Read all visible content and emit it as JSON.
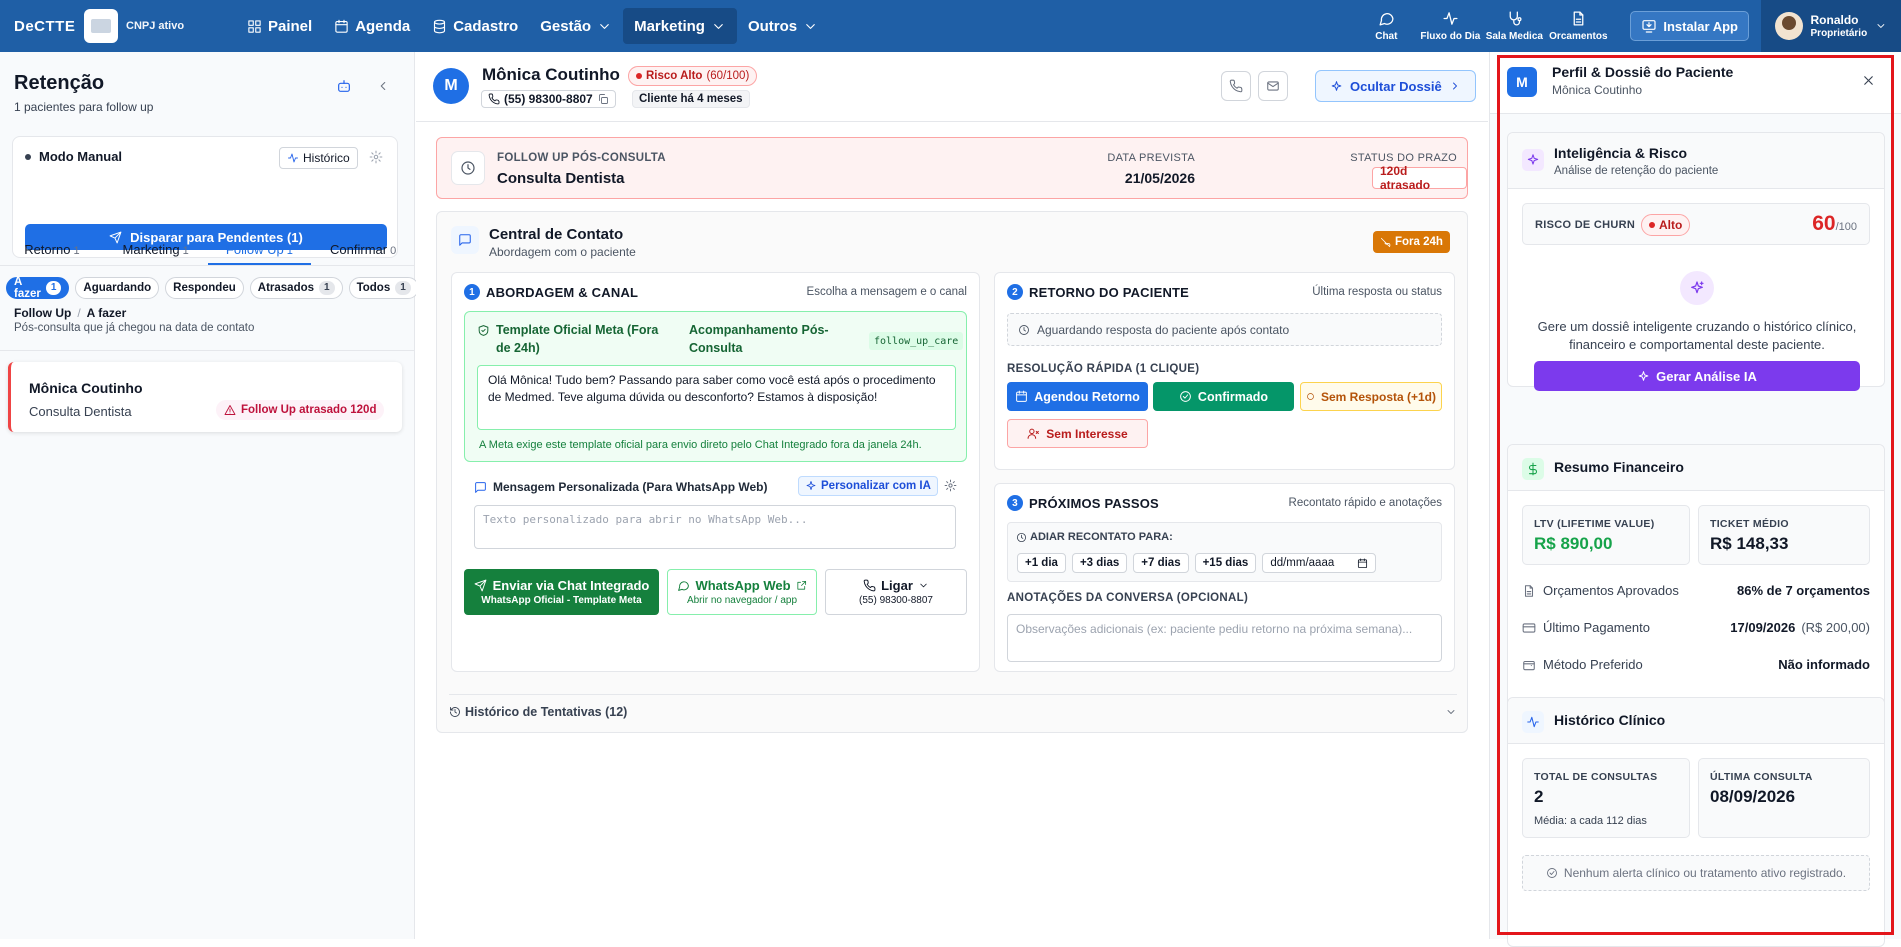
{
  "topbar": {
    "logo": "DeCTTE",
    "cnpj": "CNPJ ativo",
    "nav": [
      {
        "label": "Painel",
        "icon": "grid-icon"
      },
      {
        "label": "Agenda",
        "icon": "calendar-icon"
      },
      {
        "label": "Cadastro",
        "icon": "database-icon"
      },
      {
        "label": "Gestão",
        "icon": "chevron-down-icon"
      },
      {
        "label": "Marketing",
        "icon": "chevron-down-icon"
      },
      {
        "label": "Outros",
        "icon": "chevron-down-icon"
      }
    ],
    "tools": [
      "Chat",
      "Fluxo do Dia",
      "Sala Medica",
      "Orcamentos"
    ],
    "install": "Instalar App",
    "user_name": "Ronaldo",
    "user_role": "Proprietário"
  },
  "left": {
    "title": "Retenção",
    "subtitle": "1 pacientes para follow up",
    "mode": "Modo Manual",
    "history_btn": "Histórico",
    "fire_btn": "Disparar para Pendentes (1)",
    "tabs": [
      {
        "label": "Retorno",
        "count": "1"
      },
      {
        "label": "Marketing",
        "count": "1"
      },
      {
        "label": "Follow Up",
        "count": "1"
      },
      {
        "label": "Confirmar",
        "count": "0"
      }
    ],
    "pills": [
      {
        "label": "A fazer",
        "count": "1"
      },
      {
        "label": "Aguardando",
        "count": ""
      },
      {
        "label": "Respondeu",
        "count": ""
      },
      {
        "label": "Atrasados",
        "count": "1"
      },
      {
        "label": "Todos",
        "count": "1"
      }
    ],
    "crumb1": "Follow Up",
    "crumb_sep": "/",
    "crumb2": "A fazer",
    "crumb_sub": "Pós-consulta que já chegou na data de contato",
    "card_name": "Mônica Coutinho",
    "card_desc": "Consulta Dentista",
    "card_badge": "Follow Up atrasado 120d"
  },
  "mid": {
    "initial": "M",
    "name": "Mônica Coutinho",
    "risk_label": "Risco Alto",
    "risk_score": "(60/100)",
    "phone": "(55) 98300-8807",
    "since": "Cliente há 4 meses",
    "hide_btn": "Ocultar Dossiê",
    "fup_label": "FOLLOW UP PÓS-CONSULTA",
    "fup_value": "Consulta Dentista",
    "date_label": "DATA PREVISTA",
    "date_value": "21/05/2026",
    "status_label": "STATUS DO PRAZO",
    "status_value": "120d atrasado",
    "cc_title": "Central de Contato",
    "cc_sub": "Abordagem com o paciente",
    "f24": "Fora 24h",
    "b1_num": "1",
    "b1_title": "ABORDAGEM & CANAL",
    "b1_right": "Escolha a mensagem e o canal",
    "tpl_a": "Template Oficial Meta (Fora de 24h)",
    "tpl_b": "Acompanhamento Pós-Consulta",
    "tpl_code": "follow_up_care",
    "tpl_msg": "Olá Mônica! Tudo bem? Passando para saber como você está após o procedimento de Medmed. Teve alguma dúvida ou desconforto? Estamos à disposição!",
    "tpl_note": "A Meta exige este template oficial para envio direto pelo Chat Integrado fora da janela 24h.",
    "custom_label": "Mensagem Personalizada (Para WhatsApp Web)",
    "ia_btn": "Personalizar com IA",
    "custom_placeholder": "Texto personalizado para abrir no WhatsApp Web...",
    "send1": "Enviar via Chat Integrado",
    "send1_sub": "WhatsApp Oficial - Template Meta",
    "send2": "WhatsApp Web",
    "send2_sub": "Abrir no navegador / app",
    "send3": "Ligar",
    "send3_sub": "(55) 98300-8807",
    "b2_num": "2",
    "b2_title": "RETORNO DO PACIENTE",
    "b2_right": "Última resposta ou status",
    "waiting": "Aguardando resposta do paciente após contato",
    "quick_title": "RESOLUÇÃO RÁPIDA (1 CLIQUE)",
    "q1": "Agendou Retorno",
    "q2": "Confirmado",
    "q3": "Sem Resposta (+1d)",
    "q4": "Sem Interesse",
    "b3_num": "3",
    "b3_title": "PRÓXIMOS PASSOS",
    "b3_right": "Recontato rápido e anotações",
    "postpone": "ADIAR RECONTATO PARA:",
    "chips": [
      "+1 dia",
      "+3 dias",
      "+7 dias",
      "+15 dias"
    ],
    "date_ph": "dd/mm/aaaa",
    "notes_label": "ANOTAÇÕES DA CONVERSA (OPCIONAL)",
    "notes_ph": "Observações adicionais (ex: paciente pediu retorno na próxima semana)...",
    "history": "Histórico de Tentativas (12)"
  },
  "right": {
    "initial": "M",
    "title": "Perfil & Dossiê do Paciente",
    "subtitle": "Mônica Coutinho",
    "intel_title": "Inteligência & Risco",
    "intel_sub": "Análise de retenção do paciente",
    "churn_label": "RISCO DE CHURN",
    "churn_badge": "Alto",
    "churn_value": "60",
    "churn_max": "/100",
    "gen_text": "Gere um dossiê inteligente cruzando o histórico clínico, financeiro e comportamental deste paciente.",
    "gen_btn": "Gerar Análise IA",
    "fin_title": "Resumo Financeiro",
    "ltv_label": "LTV (LIFETIME VALUE)",
    "ltv_value": "R$ 890,00",
    "ticket_label": "TICKET MÉDIO",
    "ticket_value": "R$ 148,33",
    "rows": [
      {
        "label": "Orçamentos Aprovados",
        "value": "86% de 7 orçamentos",
        "extra": ""
      },
      {
        "label": "Último Pagamento",
        "value": "17/09/2026",
        "extra": "(R$ 200,00)"
      },
      {
        "label": "Método Preferido",
        "value": "Não informado",
        "extra": ""
      }
    ],
    "clin_title": "Histórico Clínico",
    "total_label": "TOTAL DE CONSULTAS",
    "total_value": "2",
    "total_sub": "Média: a cada 112 dias",
    "last_label": "ÚLTIMA CONSULTA",
    "last_value": "08/09/2026",
    "alert": "Nenhum alerta clínico ou tratamento ativo registrado."
  },
  "colors": {
    "primary": "#1f5fa6",
    "accent": "#1f6fe5",
    "danger": "#dc2626",
    "success": "#16a34a",
    "purple": "#7c3aed",
    "warning": "#d97706"
  }
}
